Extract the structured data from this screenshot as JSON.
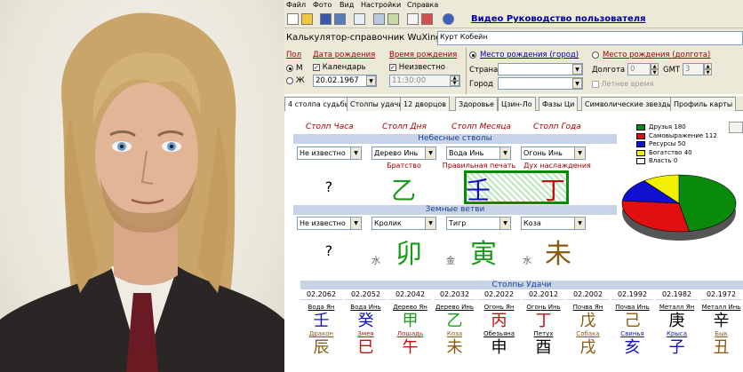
{
  "menu": [
    "Файл",
    "Фото",
    "Вид",
    "Настройки",
    "Справка"
  ],
  "toolbar": {
    "help_link": "Видео Руководство пользователя"
  },
  "app": {
    "title": "Калькулятор-справочник WuXing",
    "name_value": "Курт Кобейн"
  },
  "form": {
    "gender_label": "Пол",
    "gender_m": "М",
    "gender_f": "Ж",
    "birthdate_label": "Дата рождения",
    "calendar_label": "Календарь",
    "birthdate_value": "20.02.1967",
    "birthtime_label": "Время рождения",
    "unknown_label": "Неизвестно",
    "birthtime_value": "11:30:00",
    "place_city_label": "Место рождения (город)",
    "country_label": "Страна",
    "city_label": "Город",
    "place_lon_label": "Место рождения (долгота)",
    "longitude_label": "Долгота",
    "longitude_value": "0",
    "gmt_label": "GMT",
    "gmt_value": "3",
    "summer_time_label": "Летнее время"
  },
  "tabs": [
    "4 столпа судьбы",
    "Столпы удачи",
    "12 дворцов",
    "Здоровье",
    "Цзин-Ло",
    "Фазы Ци",
    "Символические звезды",
    "Профиль карты"
  ],
  "pillars": {
    "headers": [
      "Столп Часа",
      "Столп Дня",
      "Столп Месяца",
      "Столп Года"
    ],
    "heavenly_band": "Небесные стволы",
    "earthly_band": "Земные ветви",
    "stem_selects": [
      "Не известно",
      "Дерево Инь",
      "Вода Инь",
      "Огонь Инь"
    ],
    "stars": [
      "",
      "Братство",
      "Правильная печать",
      "Дух наслаждения"
    ],
    "stems": [
      "?",
      "乙",
      "壬",
      "丁"
    ],
    "stem_colors": [
      "#000000",
      "#1a9a1a",
      "#1010c0",
      "#c01010"
    ],
    "branch_selects": [
      "Не известно",
      "Кролик",
      "Тигр",
      "Коза"
    ],
    "branches": [
      "?",
      "卯",
      "寅",
      "未"
    ],
    "branch_colors": [
      "#000000",
      "#1a9a1a",
      "#1a9a1a",
      "#8a5a10"
    ],
    "hidden": [
      "",
      "水",
      "金",
      "水"
    ]
  },
  "luck": {
    "band": "Столпы Удачи",
    "columns": [
      {
        "year": "02.2062",
        "stem_name": "Вода Ян",
        "stem": "壬",
        "stem_color": "#1010c0",
        "animal": "Дракон",
        "branch": "辰",
        "branch_color": "#8a5a10"
      },
      {
        "year": "02.2052",
        "stem_name": "Вода Инь",
        "stem": "癸",
        "stem_color": "#1010c0",
        "animal": "Змея",
        "branch": "巳",
        "branch_color": "#c01010"
      },
      {
        "year": "02.2042",
        "stem_name": "Дерево Ян",
        "stem": "甲",
        "stem_color": "#1a9a1a",
        "animal": "Лошадь",
        "branch": "午",
        "branch_color": "#c01010"
      },
      {
        "year": "02.2032",
        "stem_name": "Дерево Инь",
        "stem": "乙",
        "stem_color": "#1a9a1a",
        "animal": "Коза",
        "branch": "未",
        "branch_color": "#8a5a10"
      },
      {
        "year": "02.2022",
        "stem_name": "Огонь Ян",
        "stem": "丙",
        "stem_color": "#c01010",
        "animal": "Обезьяна",
        "branch": "申",
        "branch_color": "#000000"
      },
      {
        "year": "02.2012",
        "stem_name": "Огонь Инь",
        "stem": "丁",
        "stem_color": "#c01010",
        "animal": "Петух",
        "branch": "酉",
        "branch_color": "#000000"
      },
      {
        "year": "02.2002",
        "stem_name": "Почва Ян",
        "stem": "戊",
        "stem_color": "#8a5a10",
        "animal": "Собака",
        "branch": "戌",
        "branch_color": "#8a5a10"
      },
      {
        "year": "02.1992",
        "stem_name": "Почва Инь",
        "stem": "己",
        "stem_color": "#8a5a10",
        "animal": "Свинья",
        "branch": "亥",
        "branch_color": "#1010c0"
      },
      {
        "year": "02.1982",
        "stem_name": "Металл Ян",
        "stem": "庚",
        "stem_color": "#000000",
        "animal": "Крыса",
        "branch": "子",
        "branch_color": "#1010c0"
      },
      {
        "year": "02.1972",
        "stem_name": "Металл Инь",
        "stem": "辛",
        "stem_color": "#000000",
        "animal": "Бык",
        "branch": "丑",
        "branch_color": "#8a5a10"
      }
    ]
  },
  "chart_data": {
    "type": "pie",
    "legend_position": "top",
    "series": [
      {
        "name": "Друзья",
        "value": 180,
        "color": "#0a8a0a"
      },
      {
        "name": "Самовыражение",
        "value": 112,
        "color": "#e01010"
      },
      {
        "name": "Ресурсы",
        "value": 50,
        "color": "#1010d0"
      },
      {
        "name": "Богатство",
        "value": 40,
        "color": "#f0f000"
      },
      {
        "name": "Власть",
        "value": 0,
        "color": "#ffffff"
      }
    ]
  }
}
